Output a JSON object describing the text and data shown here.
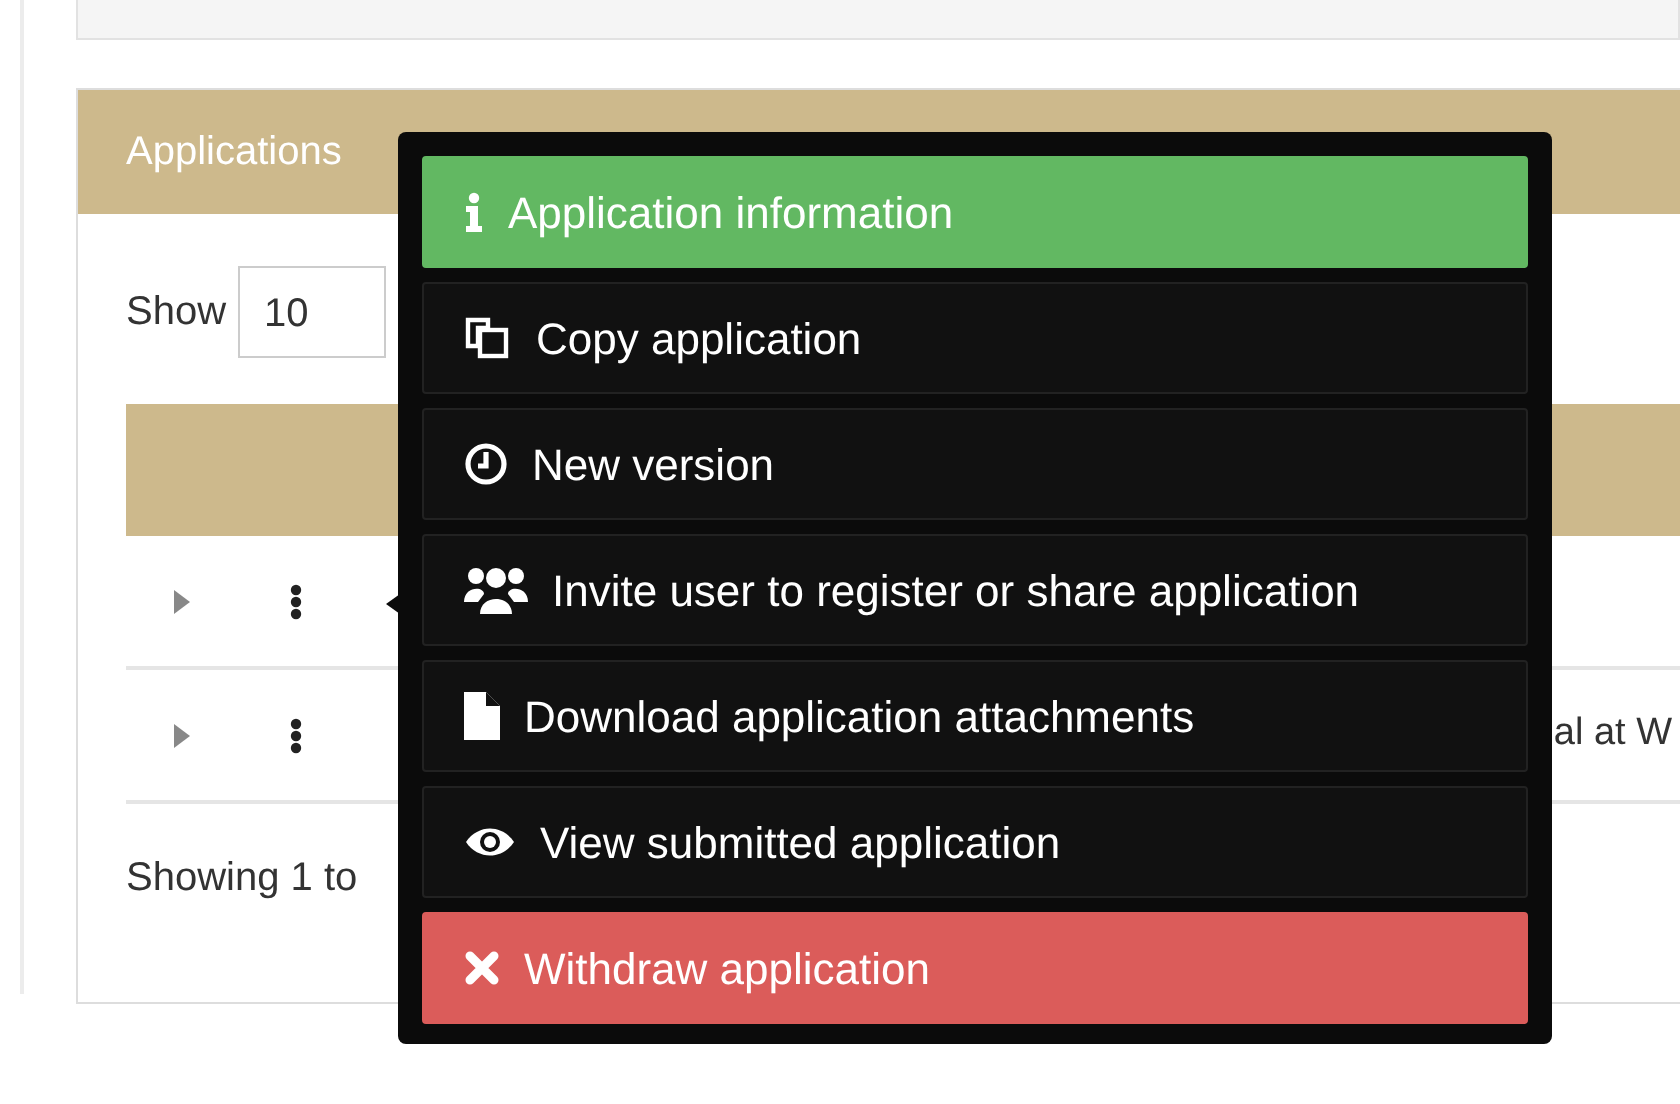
{
  "panel": {
    "title": "Applications"
  },
  "length_menu": {
    "label": "Show",
    "value": "10"
  },
  "rows": [
    {
      "menu_open": true
    },
    {
      "menu_open": false,
      "title": "al at W"
    }
  ],
  "footer": {
    "info": "Showing 1 to"
  },
  "context_menu": {
    "items": [
      {
        "kind": "info",
        "label": "Application information"
      },
      {
        "kind": "copy",
        "label": "Copy application"
      },
      {
        "kind": "version",
        "label": "New version"
      },
      {
        "kind": "invite",
        "label": "Invite user to register or share application"
      },
      {
        "kind": "download",
        "label": "Download application attachments"
      },
      {
        "kind": "view",
        "label": "View submitted application"
      },
      {
        "kind": "withdraw",
        "label": "Withdraw application"
      }
    ]
  }
}
